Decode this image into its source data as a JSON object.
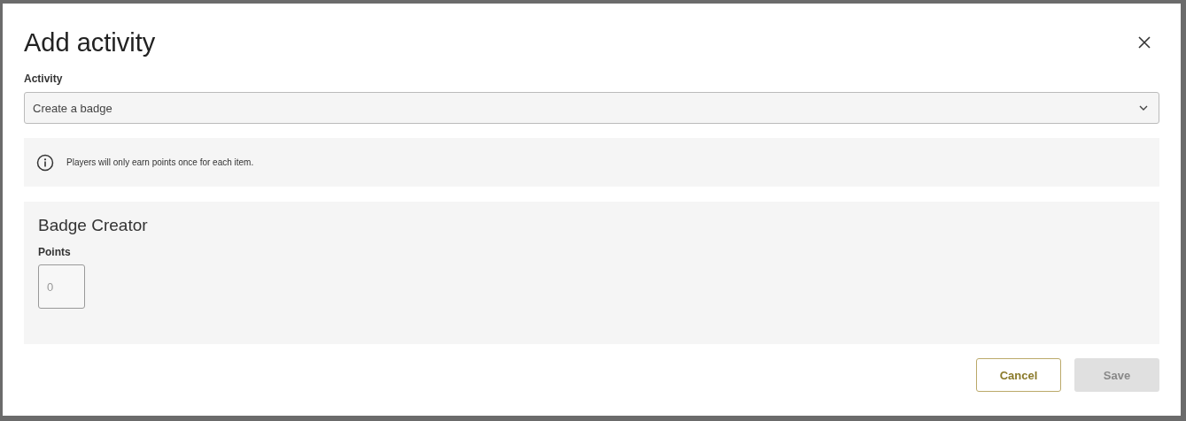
{
  "dialog": {
    "title": "Add activity"
  },
  "activity": {
    "label": "Activity",
    "value": "Create a badge"
  },
  "info": {
    "text": "Players will only earn points once for each item."
  },
  "section": {
    "title": "Badge Creator",
    "points_label": "Points",
    "points_placeholder": "0"
  },
  "buttons": [
    {
      "label": "Cancel",
      "kind": "secondary",
      "disabled": false
    },
    {
      "label": "Save",
      "kind": "primary",
      "disabled": true
    }
  ]
}
